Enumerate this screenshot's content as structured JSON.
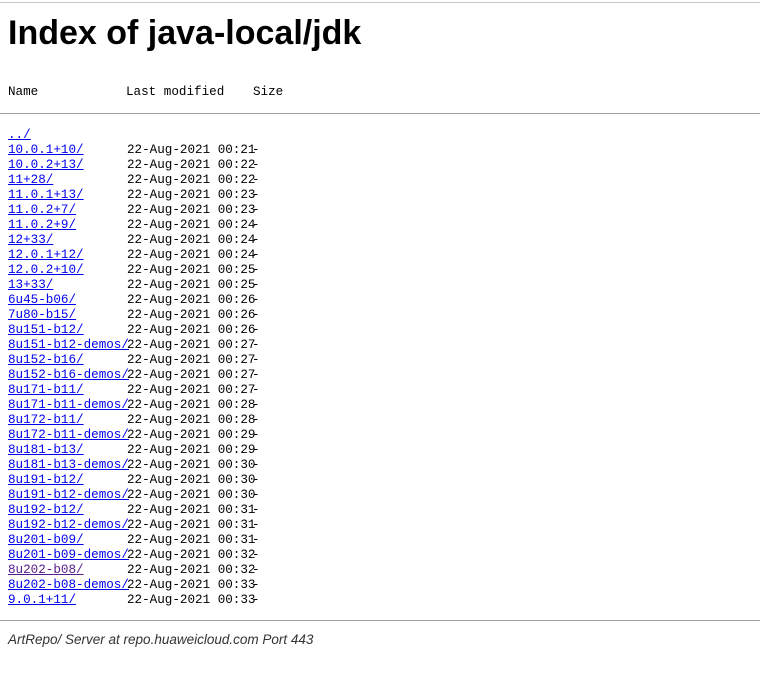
{
  "page": {
    "title": "Index of java-local/jdk",
    "footer": "ArtRepo/ Server at repo.huaweicloud.com Port 443"
  },
  "columns": {
    "name": "Name",
    "modified": "Last modified",
    "size": "Size"
  },
  "entries": [
    {
      "name": "../",
      "date": "",
      "size": ""
    },
    {
      "name": "10.0.1+10/",
      "date": "22-Aug-2021 00:21",
      "size": "-"
    },
    {
      "name": "10.0.2+13/",
      "date": "22-Aug-2021 00:22",
      "size": "-"
    },
    {
      "name": "11+28/",
      "date": "22-Aug-2021 00:22",
      "size": "-"
    },
    {
      "name": "11.0.1+13/",
      "date": "22-Aug-2021 00:23",
      "size": "-"
    },
    {
      "name": "11.0.2+7/",
      "date": "22-Aug-2021 00:23",
      "size": "-"
    },
    {
      "name": "11.0.2+9/",
      "date": "22-Aug-2021 00:24",
      "size": "-"
    },
    {
      "name": "12+33/",
      "date": "22-Aug-2021 00:24",
      "size": "-"
    },
    {
      "name": "12.0.1+12/",
      "date": "22-Aug-2021 00:24",
      "size": "-"
    },
    {
      "name": "12.0.2+10/",
      "date": "22-Aug-2021 00:25",
      "size": "-"
    },
    {
      "name": "13+33/",
      "date": "22-Aug-2021 00:25",
      "size": "-"
    },
    {
      "name": "6u45-b06/",
      "date": "22-Aug-2021 00:26",
      "size": "-"
    },
    {
      "name": "7u80-b15/",
      "date": "22-Aug-2021 00:26",
      "size": "-"
    },
    {
      "name": "8u151-b12/",
      "date": "22-Aug-2021 00:26",
      "size": "-"
    },
    {
      "name": "8u151-b12-demos/",
      "date": "22-Aug-2021 00:27",
      "size": "-"
    },
    {
      "name": "8u152-b16/",
      "date": "22-Aug-2021 00:27",
      "size": "-"
    },
    {
      "name": "8u152-b16-demos/",
      "date": "22-Aug-2021 00:27",
      "size": "-"
    },
    {
      "name": "8u171-b11/",
      "date": "22-Aug-2021 00:27",
      "size": "-"
    },
    {
      "name": "8u171-b11-demos/",
      "date": "22-Aug-2021 00:28",
      "size": "-"
    },
    {
      "name": "8u172-b11/",
      "date": "22-Aug-2021 00:28",
      "size": "-"
    },
    {
      "name": "8u172-b11-demos/",
      "date": "22-Aug-2021 00:29",
      "size": "-"
    },
    {
      "name": "8u181-b13/",
      "date": "22-Aug-2021 00:29",
      "size": "-"
    },
    {
      "name": "8u181-b13-demos/",
      "date": "22-Aug-2021 00:30",
      "size": "-"
    },
    {
      "name": "8u191-b12/",
      "date": "22-Aug-2021 00:30",
      "size": "-"
    },
    {
      "name": "8u191-b12-demos/",
      "date": "22-Aug-2021 00:30",
      "size": "-"
    },
    {
      "name": "8u192-b12/",
      "date": "22-Aug-2021 00:31",
      "size": "-"
    },
    {
      "name": "8u192-b12-demos/",
      "date": "22-Aug-2021 00:31",
      "size": "-"
    },
    {
      "name": "8u201-b09/",
      "date": "22-Aug-2021 00:31",
      "size": "-"
    },
    {
      "name": "8u201-b09-demos/",
      "date": "22-Aug-2021 00:32",
      "size": "-"
    },
    {
      "name": "8u202-b08/",
      "date": "22-Aug-2021 00:32",
      "size": "-",
      "visited": true
    },
    {
      "name": "8u202-b08-demos/",
      "date": "22-Aug-2021 00:33",
      "size": "-"
    },
    {
      "name": "9.0.1+11/",
      "date": "22-Aug-2021 00:33",
      "size": "-"
    }
  ],
  "colors": {
    "link": "#0000ee",
    "visited_link": "#551a8b",
    "rule": "#a0a0a0"
  }
}
